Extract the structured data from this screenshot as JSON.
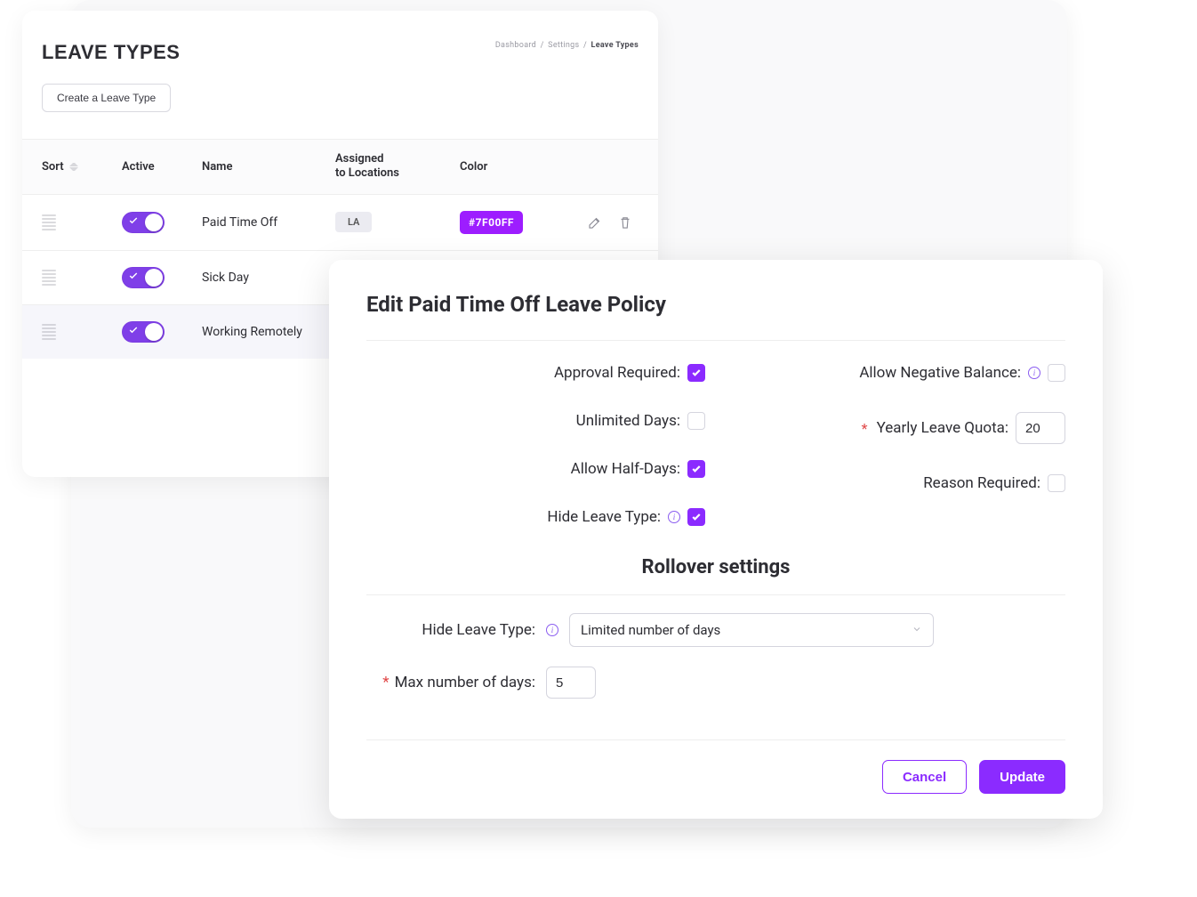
{
  "page": {
    "title": "LEAVE TYPES",
    "breadcrumb": [
      "Dashboard",
      "Settings",
      "Leave Types"
    ],
    "create_button": "Create a Leave Type"
  },
  "table": {
    "columns": {
      "sort": "Sort",
      "active": "Active",
      "name": "Name",
      "assigned": "Assigned to Locations",
      "color": "Color"
    },
    "rows": [
      {
        "name": "Paid Time Off",
        "active": true,
        "location": "LA",
        "color_hex": "#7F00FF",
        "selected": false
      },
      {
        "name": "Sick Day",
        "active": true,
        "location": "",
        "color_hex": "",
        "selected": false
      },
      {
        "name": "Working Remotely",
        "active": true,
        "location": "",
        "color_hex": "",
        "selected": true
      }
    ]
  },
  "modal": {
    "title": "Edit Paid Time Off Leave Policy",
    "fields": {
      "approval_required": {
        "label": "Approval Required:",
        "checked": true
      },
      "unlimited_days": {
        "label": "Unlimited Days:",
        "checked": false
      },
      "allow_half_days": {
        "label": "Allow Half-Days:",
        "checked": true
      },
      "hide_leave_type": {
        "label": "Hide Leave Type:",
        "checked": true,
        "info": true
      },
      "allow_negative_balance": {
        "label": "Allow Negative Balance:",
        "checked": false,
        "info": true
      },
      "yearly_leave_quota": {
        "label": "Yearly Leave Quota:",
        "value": "20",
        "required": true
      },
      "reason_required": {
        "label": "Reason Required:",
        "checked": false
      }
    },
    "rollover": {
      "title": "Rollover settings",
      "hide_leave_type": {
        "label": "Hide Leave Type:",
        "info": true,
        "select_value": "Limited number of days"
      },
      "max_days": {
        "label": "Max number of days:",
        "value": "5",
        "required": true
      }
    },
    "buttons": {
      "cancel": "Cancel",
      "update": "Update"
    }
  }
}
